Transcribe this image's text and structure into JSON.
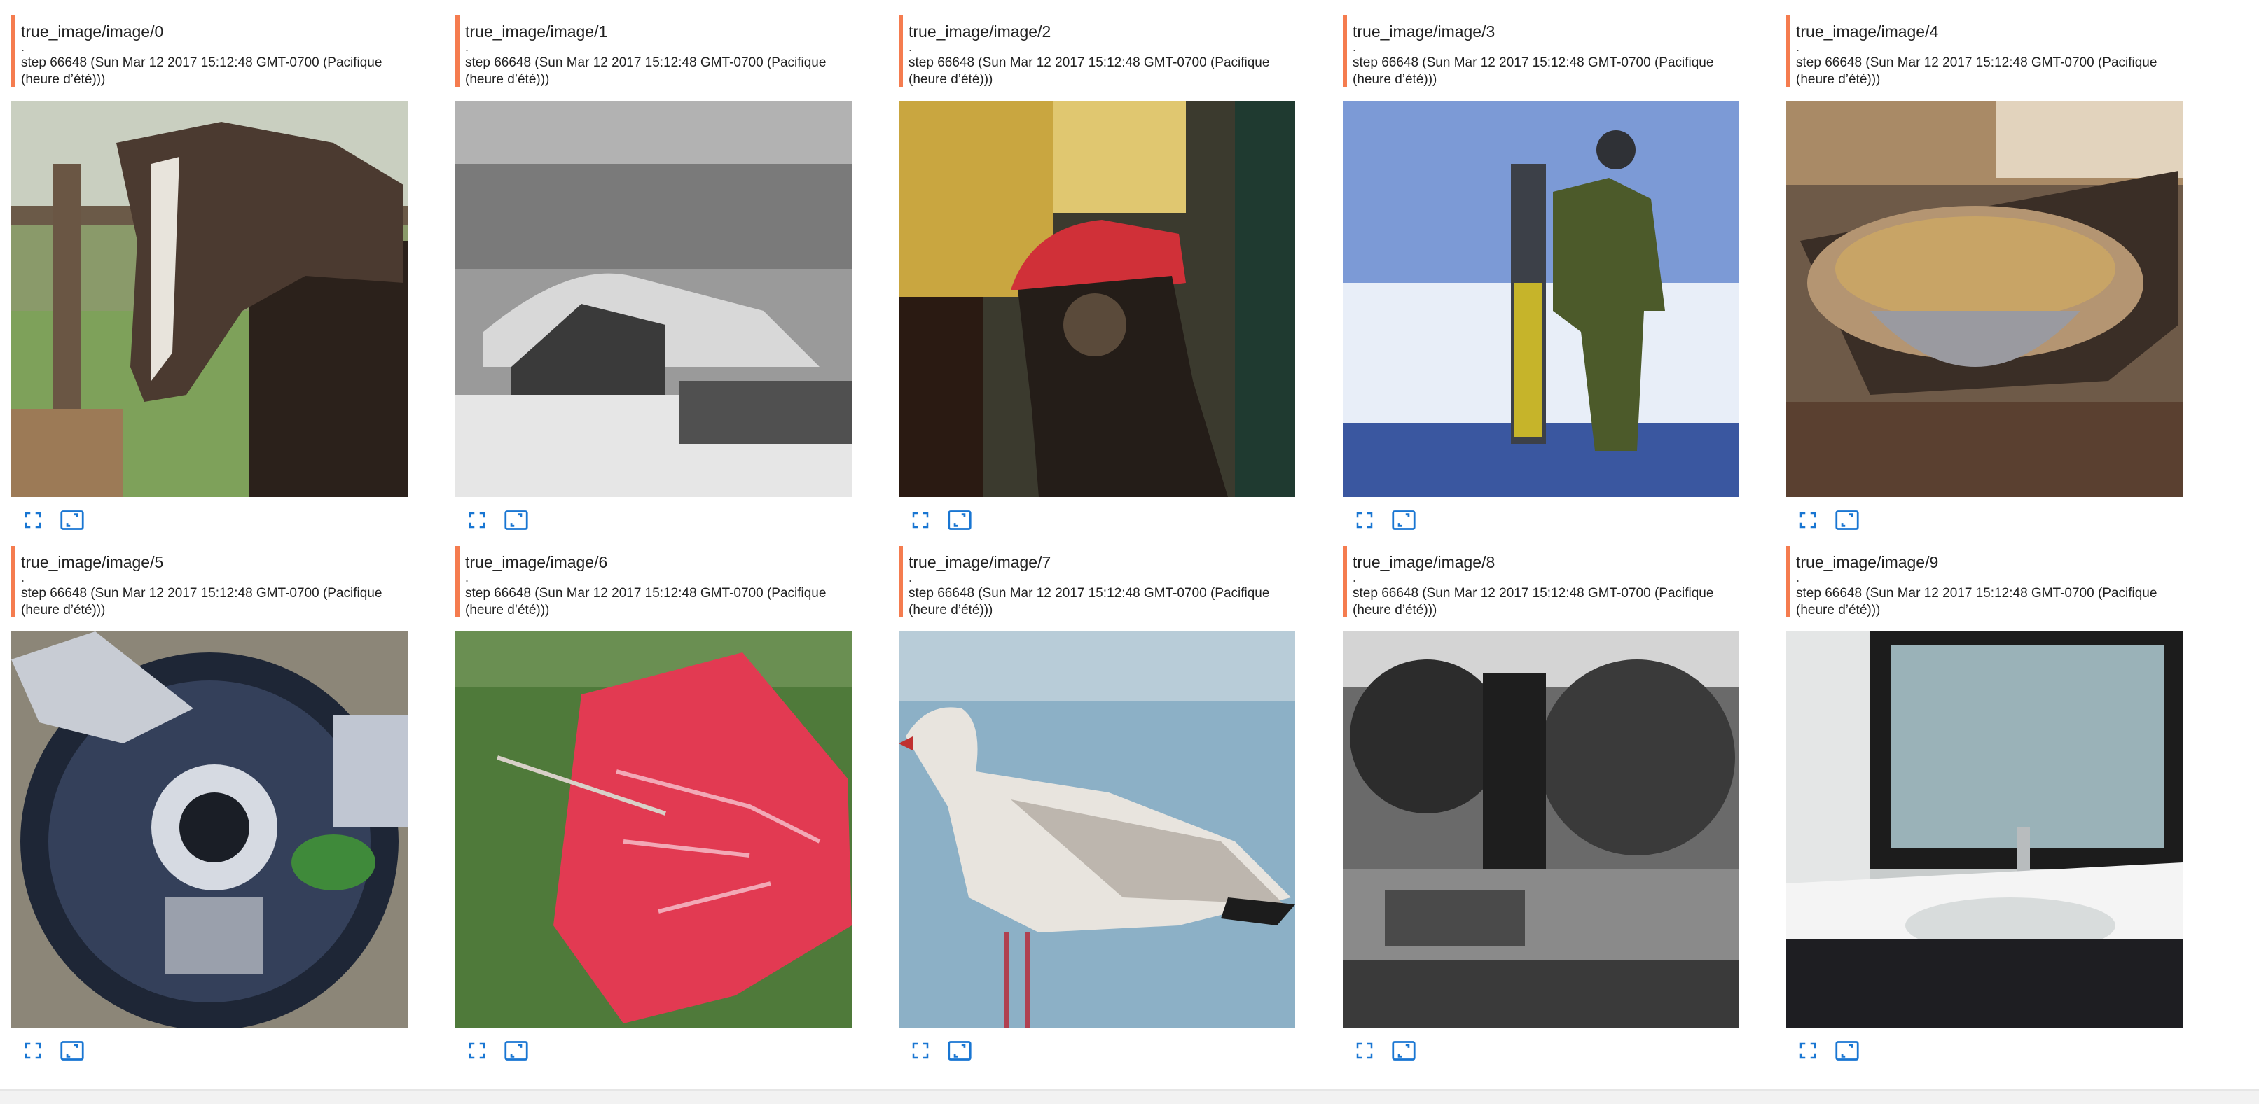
{
  "accent_color": "#f57c4f",
  "icon_color": "#1976d2",
  "cards": [
    {
      "tag": "true_image/image/0",
      "dot": ".",
      "step": "step 66648 (Sun Mar 12 2017 15:12:48 GMT-0700 (Pacifique (heure d’été)))",
      "icons": [
        "fullscreen-icon",
        "actual-size-icon"
      ]
    },
    {
      "tag": "true_image/image/1",
      "dot": ".",
      "step": "step 66648 (Sun Mar 12 2017 15:12:48 GMT-0700 (Pacifique (heure d’été)))",
      "icons": [
        "fullscreen-icon",
        "actual-size-icon"
      ]
    },
    {
      "tag": "true_image/image/2",
      "dot": ".",
      "step": "step 66648 (Sun Mar 12 2017 15:12:48 GMT-0700 (Pacifique (heure d’été)))",
      "icons": [
        "fullscreen-icon",
        "actual-size-icon"
      ]
    },
    {
      "tag": "true_image/image/3",
      "dot": ".",
      "step": "step 66648 (Sun Mar 12 2017 15:12:48 GMT-0700 (Pacifique (heure d’été)))",
      "icons": [
        "fullscreen-icon",
        "actual-size-icon"
      ]
    },
    {
      "tag": "true_image/image/4",
      "dot": ".",
      "step": "step 66648 (Sun Mar 12 2017 15:12:48 GMT-0700 (Pacifique (heure d’été)))",
      "icons": [
        "fullscreen-icon",
        "actual-size-icon"
      ]
    },
    {
      "tag": "true_image/image/5",
      "dot": ".",
      "step": "step 66648 (Sun Mar 12 2017 15:12:48 GMT-0700 (Pacifique (heure d’été)))",
      "icons": [
        "fullscreen-icon",
        "actual-size-icon"
      ]
    },
    {
      "tag": "true_image/image/6",
      "dot": ".",
      "step": "step 66648 (Sun Mar 12 2017 15:12:48 GMT-0700 (Pacifique (heure d’été)))",
      "icons": [
        "fullscreen-icon",
        "actual-size-icon"
      ]
    },
    {
      "tag": "true_image/image/7",
      "dot": ".",
      "step": "step 66648 (Sun Mar 12 2017 15:12:48 GMT-0700 (Pacifique (heure d’été)))",
      "icons": [
        "fullscreen-icon",
        "actual-size-icon"
      ]
    },
    {
      "tag": "true_image/image/8",
      "dot": ".",
      "step": "step 66648 (Sun Mar 12 2017 15:12:48 GMT-0700 (Pacifique (heure d’été)))",
      "icons": [
        "fullscreen-icon",
        "actual-size-icon"
      ]
    },
    {
      "tag": "true_image/image/9",
      "dot": ".",
      "step": "step 66648 (Sun Mar 12 2017 15:12:48 GMT-0700 (Pacifique (heure d’été)))",
      "icons": [
        "fullscreen-icon",
        "actual-size-icon"
      ]
    }
  ]
}
